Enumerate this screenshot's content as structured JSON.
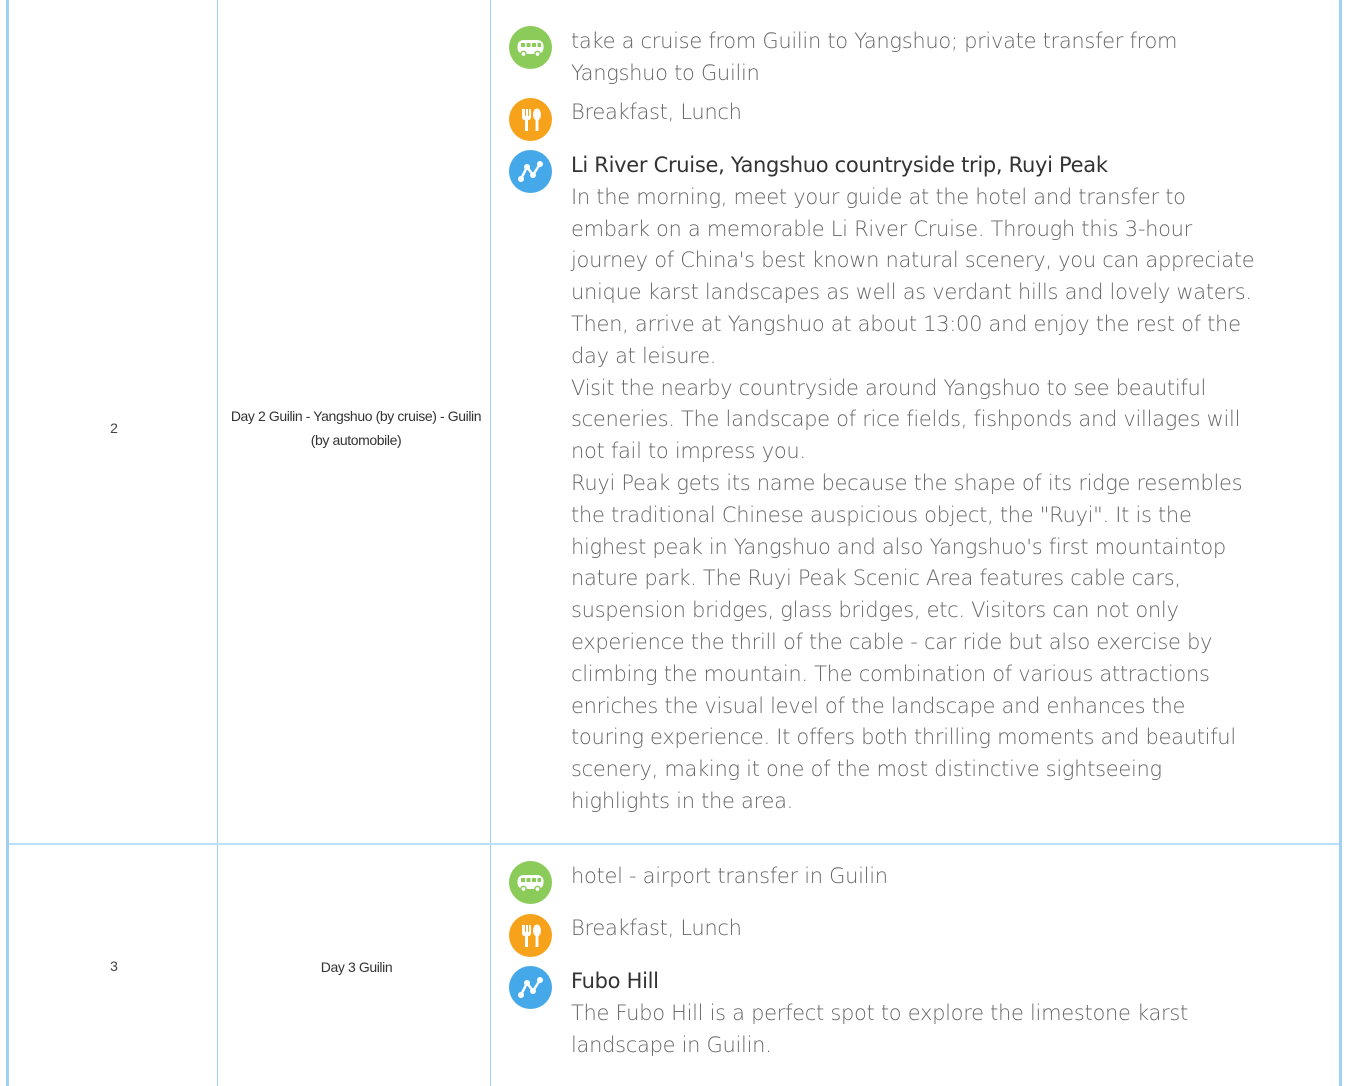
{
  "rows": [
    {
      "day_number": "2",
      "day_title": "Day 2 Guilin - Yangshuo (by cruise) - Guilin (by automobile)",
      "transport": "take a cruise from Guilin to Yangshuo; private transfer from Yangshuo to Guilin",
      "meals": "Breakfast, Lunch",
      "sights_title": "Li River Cruise, Yangshuo countryside trip, Ruyi Peak",
      "descriptions": [
        "In the morning, meet your guide at the hotel and transfer to embark on a memorable Li River Cruise. Through this 3-hour journey of China's best known natural scenery, you can appreciate unique karst landscapes as well as verdant hills and lovely waters. Then, arrive at Yangshuo at about 13:00 and enjoy the rest of the day at leisure.",
        "Visit the nearby countryside around Yangshuo to see beautiful sceneries. The landscape of rice fields, fishponds and villages will not fail to impress you.",
        "Ruyi Peak gets its name because the shape of its ridge resembles the traditional Chinese auspicious object, the \"Ruyi\". It is the highest peak in Yangshuo and also Yangshuo's first mountaintop nature park. The Ruyi Peak Scenic Area features cable cars, suspension bridges, glass bridges, etc. Visitors can not only experience the thrill of the cable - car ride but also exercise by climbing the mountain. The combination of various attractions enriches the visual level of the landscape and enhances the touring experience. It offers both thrilling moments and beautiful scenery, making it one of the most distinctive sightseeing highlights in the area."
      ]
    },
    {
      "day_number": "3",
      "day_title": "Day 3 Guilin",
      "transport": "hotel - airport transfer in Guilin",
      "meals": "Breakfast, Lunch",
      "sights_title": "Fubo Hill",
      "descriptions": [
        "The Fubo Hill is a perfect spot to explore the limestone karst landscape in Guilin."
      ]
    }
  ],
  "icons": {
    "transport": "bus-icon",
    "meals": "fork-spoon-icon",
    "sights": "route-icon"
  },
  "colors": {
    "border": "#9fd2f2",
    "bus_icon": "#8bcb5a",
    "meal_icon": "#f7a21b",
    "route_icon": "#45a8e9",
    "body_text": "#666666"
  }
}
